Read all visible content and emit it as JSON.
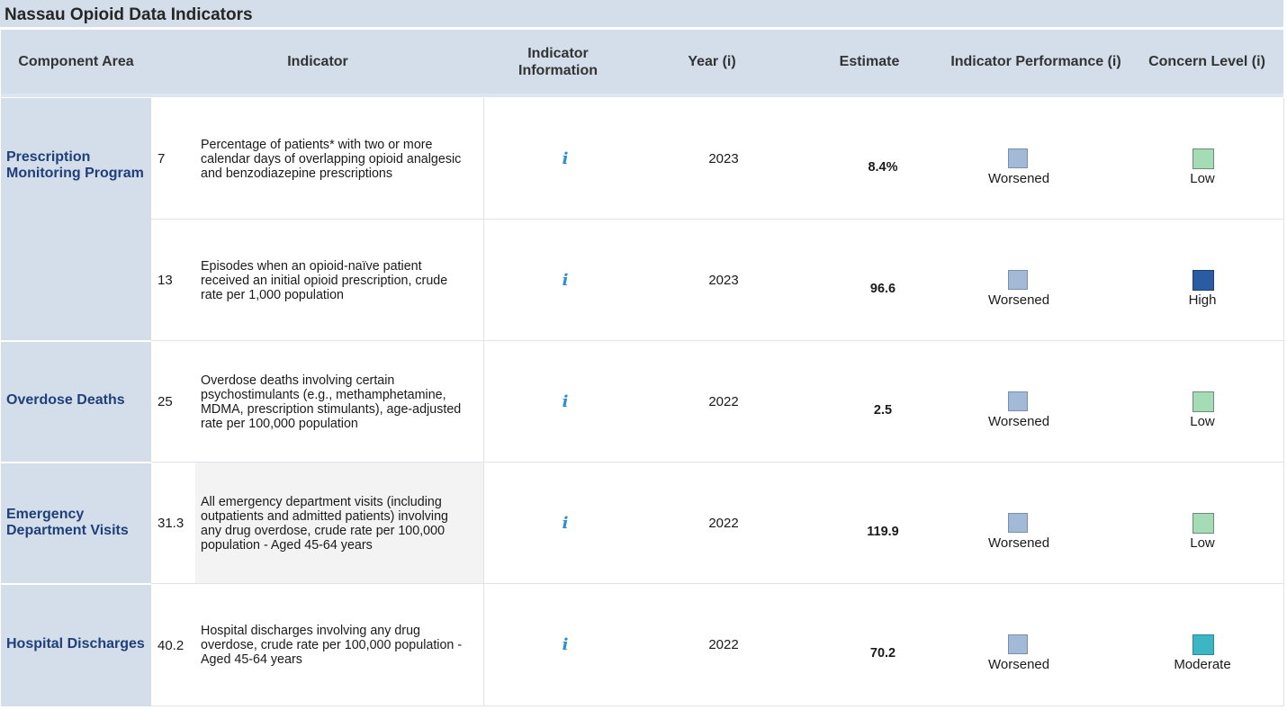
{
  "page": {
    "title": "Nassau Opioid Data Indicators"
  },
  "columns": {
    "component_area": "Component Area",
    "indicator": "Indicator",
    "indicator_information_line1": "Indicator",
    "indicator_information_line2": "Information",
    "year": "Year (i)",
    "estimate": "Estimate",
    "indicator_performance": "Indicator Performance (i)",
    "concern_level": "Concern Level (i)"
  },
  "components": [
    {
      "label_line1": "Prescription",
      "label_line2": "Monitoring Program"
    },
    {
      "label_line1": "Overdose Deaths",
      "label_line2": ""
    },
    {
      "label_line1": "Emergency",
      "label_line2": "Department Visits"
    },
    {
      "label_line1": "Hospital Discharges",
      "label_line2": ""
    }
  ],
  "rows": [
    {
      "number": "7",
      "indicator_lines": [
        "Percentage of patients* with two or more",
        "calendar days of overlapping opioid analgesic",
        "and benzodiazepine prescriptions"
      ],
      "info_icon": "i",
      "year": "2023",
      "estimate": "8.4%",
      "performance": "Worsened",
      "performance_color": "#a3b9d8",
      "concern": "Low",
      "concern_color": "#a6dcb5"
    },
    {
      "number": "13",
      "indicator_lines": [
        "Episodes when an opioid-naïve patient",
        "received an initial opioid prescription, crude",
        "rate per 1,000 population"
      ],
      "info_icon": "i",
      "year": "2023",
      "estimate": "96.6",
      "performance": "Worsened",
      "performance_color": "#a3b9d8",
      "concern": "High",
      "concern_color": "#2a5ca3"
    },
    {
      "number": "25",
      "indicator_lines": [
        "Overdose deaths involving certain",
        "psychostimulants (e.g., methamphetamine,",
        "MDMA, prescription stimulants), age-adjusted",
        "rate per 100,000 population"
      ],
      "info_icon": "i",
      "year": "2022",
      "estimate": "2.5",
      "performance": "Worsened",
      "performance_color": "#a3b9d8",
      "concern": "Low",
      "concern_color": "#a6dcb5"
    },
    {
      "number": "31.3",
      "indicator_lines": [
        "All emergency department visits (including",
        "outpatients and admitted patients) involving",
        "any drug overdose, crude rate per 100,000",
        "population - Aged 45-64 years"
      ],
      "info_icon": "i",
      "year": "2022",
      "estimate": "119.9",
      "performance": "Worsened",
      "performance_color": "#a3b9d8",
      "concern": "Low",
      "concern_color": "#a6dcb5",
      "highlight": true
    },
    {
      "number": "40.2",
      "indicator_lines": [
        "Hospital discharges involving any drug",
        "overdose, crude rate per 100,000 population -",
        "Aged 45-64 years"
      ],
      "info_icon": "i",
      "year": "2022",
      "estimate": "70.2",
      "performance": "Worsened",
      "performance_color": "#a3b9d8",
      "concern": "Moderate",
      "concern_color": "#3cb5c4"
    }
  ]
}
